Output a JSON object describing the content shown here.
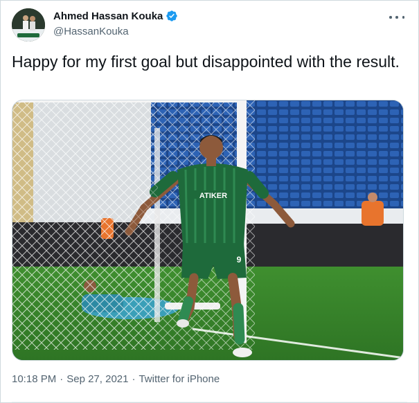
{
  "user": {
    "display_name": "Ahmed Hassan Kouka",
    "handle": "@HassanKouka",
    "verified": true
  },
  "icons": {
    "verified": "verified-badge-icon",
    "more": "more-options-icon"
  },
  "tweet": {
    "text": "Happy for my first goal but disappointed with the result."
  },
  "media": {
    "jersey_sponsor": "ATIKER",
    "shorts_number": "9"
  },
  "meta": {
    "time": "10:18 PM",
    "separator": "·",
    "date": "Sep 27, 2021",
    "source": "Twitter for iPhone"
  },
  "colors": {
    "accent": "#1d9bf0",
    "secondary_text": "#536471",
    "jersey_green": "#1e6a3b",
    "stadium_blue": "#1f4f94"
  }
}
